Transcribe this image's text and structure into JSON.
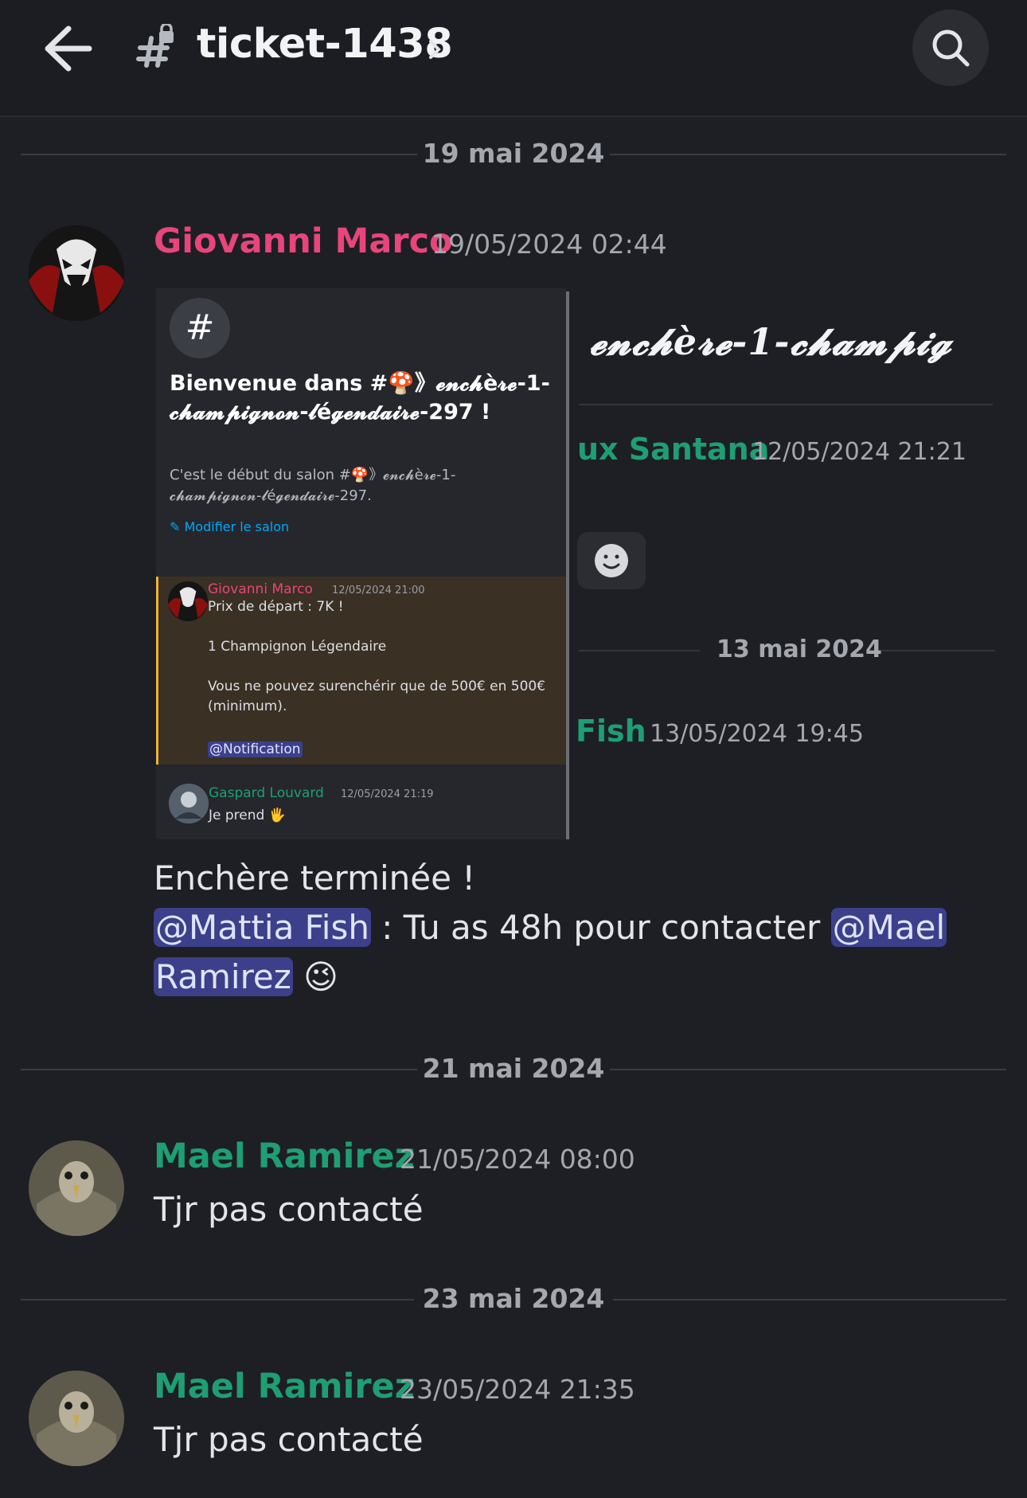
{
  "header": {
    "channel_name": "ticket-1438"
  },
  "dates": {
    "d1": "19 mai 2024",
    "d2": "21 mai 2024",
    "d3": "23 mai 2024"
  },
  "messages": [
    {
      "author": "Giovanni Marco",
      "author_color": "#e8457a",
      "timestamp": "19/05/2024 02:44",
      "line1": "Enchère terminée !",
      "mention1": "@Mattia Fish",
      "middle": " : Tu as 48h pour contacter ",
      "mention2a": "@Mael",
      "mention2b": "Ramirez",
      "emoji": "😉"
    },
    {
      "author": "Mael Ramirez",
      "author_color": "#1f9e73",
      "timestamp": "21/05/2024 08:00",
      "text": "Tjr pas contacté"
    },
    {
      "author": "Mael Ramirez",
      "author_color": "#1f9e73",
      "timestamp": "23/05/2024 21:35",
      "text": "Tjr pas contacté"
    }
  ],
  "attachment": {
    "left": {
      "hash": "#",
      "welcome_title": "Bienvenue dans #🍄》𝓮𝓷𝓬𝓱è𝓻𝓮-1-𝓬𝓱𝓪𝓶𝓹𝓲𝓰𝓷𝓸𝓷-𝓵é𝓰𝓮𝓷𝓭𝓪𝓲𝓻𝓮-297 !",
      "welcome_sub": "C'est le début du salon #🍄》𝓮𝓷𝓬𝓱è𝓻𝓮-1-𝓬𝓱𝓪𝓶𝓹𝓲𝓰𝓷𝓸𝓷-𝓵é𝓰𝓮𝓷𝓭𝓪𝓲𝓻𝓮-297.",
      "edit_link": "Modifier le salon",
      "pinned": {
        "author": "Giovanni Marco",
        "timestamp": "12/05/2024 21:00",
        "line1": "Prix de départ : 7K !",
        "line2": "1 Champignon Légendaire",
        "line3": "Vous ne pouvez surenchérir que de 500€ en 500€ (minimum).",
        "mention": "@Notification"
      },
      "reply": {
        "author": "Gaspard Louvard",
        "timestamp": "12/05/2024 21:19",
        "text": "Je prend 🖐"
      }
    },
    "right": {
      "title": "𝓮𝓷𝓬𝓱è𝓻𝓮-1-𝓬𝓱𝓪𝓶𝓹𝓲𝓰",
      "author1": "ux Santana",
      "stamp1": "12/05/2024 21:21",
      "date": "13 mai 2024",
      "author2": "Fish",
      "stamp2": "13/05/2024 19:45"
    }
  },
  "colors": {
    "background": "#1e1f24",
    "pink": "#e8457a",
    "green": "#1f9e73",
    "mention_bg": "#3c3f8a",
    "link": "#00a8fc"
  }
}
